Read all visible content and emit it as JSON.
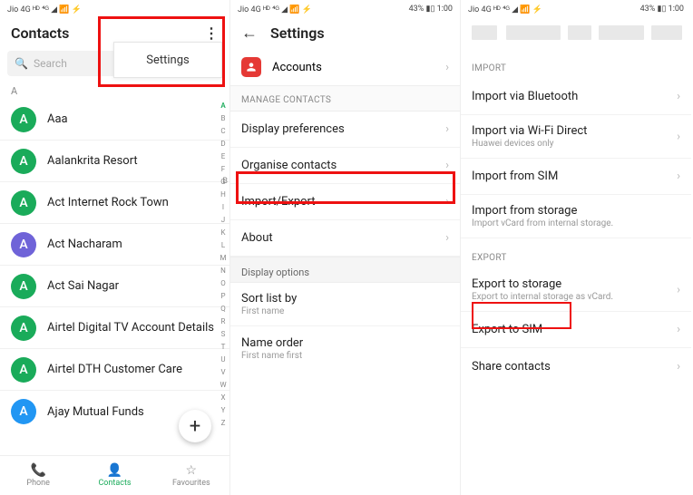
{
  "phone1": {
    "status_left": "Jio 4G ᴴᴰ ⁴ᴳ   ◢ 📶 ⚡",
    "status_right": "",
    "title": "Contacts",
    "search_placeholder": "Search",
    "settings_popup": "Settings",
    "section_letter": "A",
    "contacts": [
      {
        "initial": "A",
        "name": "Aaa",
        "color": "green"
      },
      {
        "initial": "A",
        "name": "Aalankrita Resort",
        "color": "green"
      },
      {
        "initial": "A",
        "name": "Act Internet Rock Town",
        "color": "green"
      },
      {
        "initial": "A",
        "name": "Act Nacharam",
        "color": "purple"
      },
      {
        "initial": "A",
        "name": "Act Sai Nagar",
        "color": "green"
      },
      {
        "initial": "A",
        "name": "Airtel Digital TV Account Details",
        "color": "green"
      },
      {
        "initial": "A",
        "name": "Airtel DTH Customer Care",
        "color": "green"
      },
      {
        "initial": "A",
        "name": "Ajay Mutual Funds",
        "color": "blue"
      }
    ],
    "index_letters": [
      "A",
      "B",
      "C",
      "D",
      "E",
      "F",
      "G",
      "H",
      "I",
      "J",
      "K",
      "L",
      "M",
      "N",
      "O",
      "P",
      "Q",
      "R",
      "S",
      "T",
      "U",
      "V",
      "W",
      "X",
      "Y",
      "Z"
    ],
    "index_side_B": "B",
    "nav": {
      "phone": "Phone",
      "contacts": "Contacts",
      "favourites": "Favourites"
    },
    "fab": "+"
  },
  "phone2": {
    "status_left": "Jio 4G ᴴᴰ ⁴ᴳ   ◢ 📶 ⚡",
    "status_right": "43% ▮▯ 1:00",
    "title": "Settings",
    "accounts": "Accounts",
    "manage_contacts_title": "MANAGE CONTACTS",
    "rows": {
      "display_pref": "Display preferences",
      "organise": "Organise contacts",
      "import_export": "Import/Export",
      "about": "About"
    },
    "display_options_title": "Display options",
    "sort_by": "Sort list by",
    "sort_by_sub": "First name",
    "name_order": "Name order",
    "name_order_sub": "First name first"
  },
  "phone3": {
    "status_left": "Jio 4G ᴴᴰ ⁴ᴳ   ◢ 📶 ⚡",
    "status_right": "43% ▮▯ 1:00",
    "import_title": "IMPORT",
    "import_bluetooth": "Import via Bluetooth",
    "import_wifi": "Import via Wi-Fi Direct",
    "import_wifi_sub": "Huawei devices only",
    "import_sim": "Import from SIM",
    "import_storage": "Import from storage",
    "import_storage_sub": "Import vCard from internal storage.",
    "export_title": "EXPORT",
    "export_storage": "Export to storage",
    "export_storage_sub": "Export to internal storage as vCard.",
    "export_sim": "Export to SIM",
    "share": "Share contacts"
  }
}
